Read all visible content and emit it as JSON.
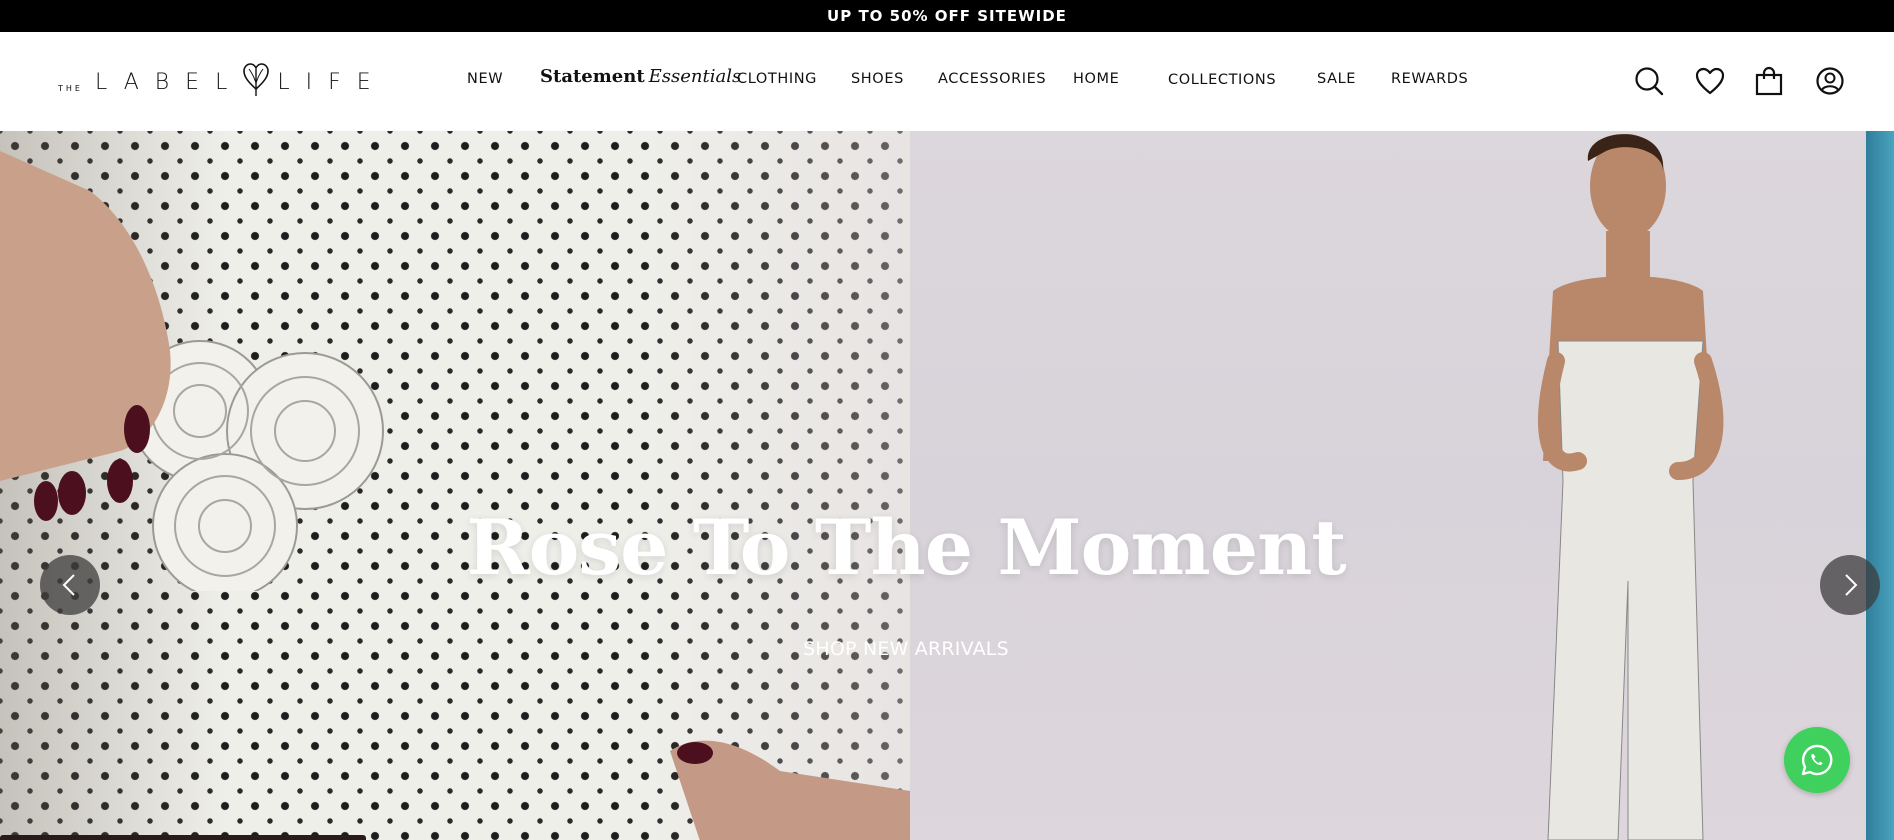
{
  "announcement": {
    "text": "UP TO 50% OFF SITEWIDE"
  },
  "brand": {
    "the": "THE",
    "word1": "LABEL",
    "word2": "LIFE"
  },
  "nav": {
    "new": "NEW",
    "statement_bold": "Statement",
    "statement_italic": "Essentials",
    "clothing": "CLOTHING",
    "shoes": "SHOES",
    "accessories": "ACCESSORIES",
    "home": "HOME",
    "collections": "COLLECTIONS",
    "sale": "SALE",
    "rewards": "REWARDS"
  },
  "header_icons": [
    "search-icon",
    "heart-icon",
    "bag-icon",
    "account-icon"
  ],
  "hero": {
    "title": "Rose To The Moment",
    "cta": "SHOP NEW ARRIVALS",
    "prev_icon": "chevron-left-icon",
    "next_icon": "chevron-right-icon"
  },
  "colors": {
    "announcement_bg": "#000000",
    "whatsapp": "#3fd05e",
    "arrow_bg": "#3c3c3c"
  }
}
